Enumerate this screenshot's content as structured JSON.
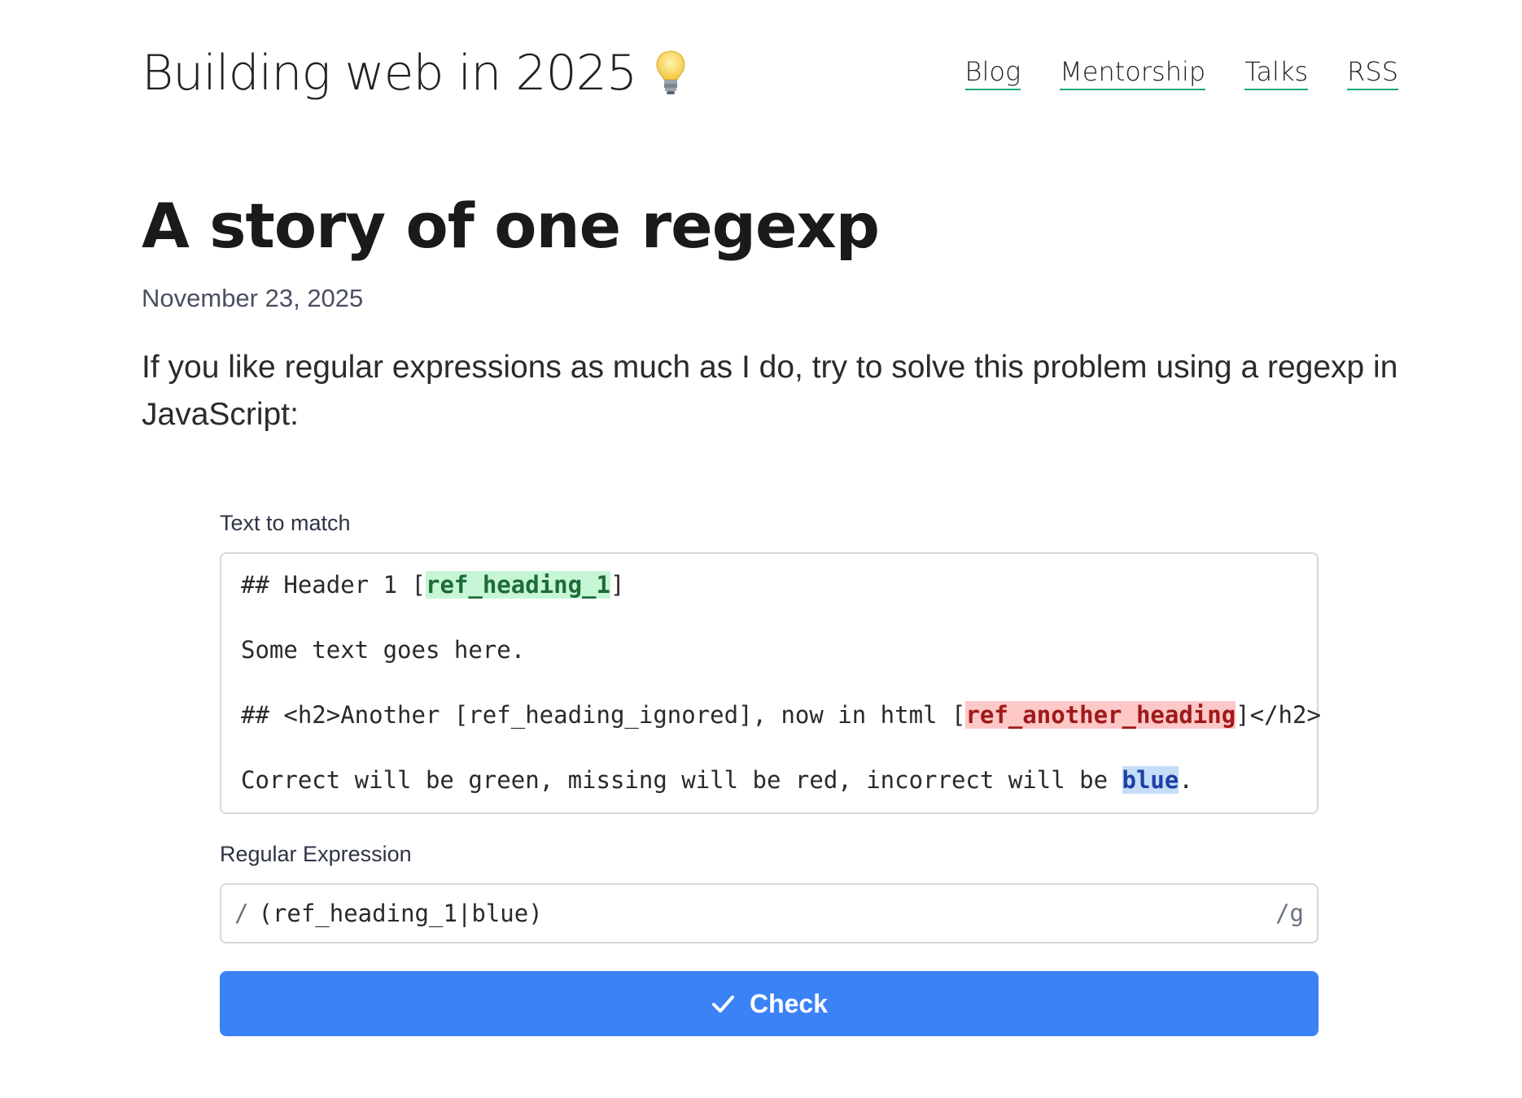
{
  "header": {
    "site_title": "Building web in 2025",
    "site_icon": "lightbulb-icon",
    "nav": [
      {
        "label": "Blog"
      },
      {
        "label": "Mentorship"
      },
      {
        "label": "Talks"
      },
      {
        "label": "RSS"
      }
    ],
    "nav_underline_color": "#19a974"
  },
  "article": {
    "title": "A story of one regexp",
    "date": "November 23, 2025",
    "intro": "If you like regular expressions as much as I do, try to solve this problem using a regexp in JavaScript:"
  },
  "widget": {
    "text_label": "Text to match",
    "lines": [
      [
        {
          "text": "## Header 1 [",
          "hl": ""
        },
        {
          "text": "ref_heading_1",
          "hl": "green"
        },
        {
          "text": "]",
          "hl": ""
        }
      ],
      [
        {
          "text": "Some text goes here.",
          "hl": ""
        }
      ],
      [
        {
          "text": "## <h2>Another [ref_heading_ignored], now in html [",
          "hl": ""
        },
        {
          "text": "ref_another_heading",
          "hl": "red"
        },
        {
          "text": "]</h2>",
          "hl": ""
        }
      ],
      [
        {
          "text": "Correct will be green, missing will be red, incorrect will be ",
          "hl": ""
        },
        {
          "text": "blue",
          "hl": "blue"
        },
        {
          "text": ".",
          "hl": ""
        }
      ]
    ],
    "highlight_colors": {
      "green": "#c6f6d5",
      "red": "#fcc8c8",
      "blue": "#c6ddf8"
    },
    "regex_label": "Regular Expression",
    "regex_prefix": "/",
    "regex_value": "(ref_heading_1|blue)",
    "regex_flags": "/g",
    "check_label": "Check",
    "check_icon": "checkmark-icon",
    "button_color": "#3b82f6"
  }
}
